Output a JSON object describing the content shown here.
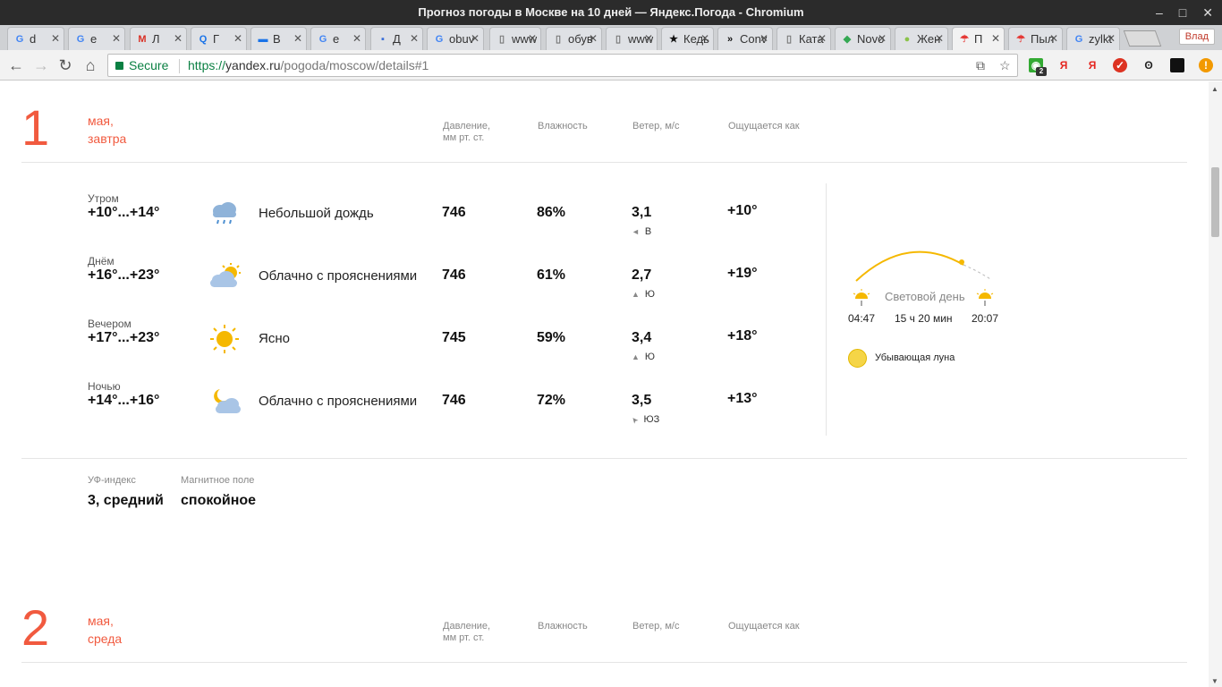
{
  "window": {
    "title": "Прогноз погоды в Москве на 10 дней — Яндекс.Погода - Chromium"
  },
  "tabs": [
    {
      "label": "d",
      "icon": "google-icon"
    },
    {
      "label": "e",
      "icon": "google-icon"
    },
    {
      "label": "Л",
      "icon": "gmail-icon"
    },
    {
      "label": "Г",
      "icon": "search-icon"
    },
    {
      "label": "B",
      "icon": "card-icon"
    },
    {
      "label": "e",
      "icon": "google-icon"
    },
    {
      "label": "Д",
      "icon": "chat-icon"
    },
    {
      "label": "obuv",
      "icon": "google-icon"
    },
    {
      "label": "www",
      "icon": "doc-icon"
    },
    {
      "label": "обув",
      "icon": "doc-icon"
    },
    {
      "label": "www",
      "icon": "doc-icon"
    },
    {
      "label": "Кедь",
      "icon": "star-icon"
    },
    {
      "label": "Conv",
      "icon": "converse-icon"
    },
    {
      "label": "Ката",
      "icon": "doc-icon"
    },
    {
      "label": "Novo",
      "icon": "maps-icon"
    },
    {
      "label": "Жен",
      "icon": "ball-icon"
    },
    {
      "label": "П",
      "icon": "umbrella-icon"
    },
    {
      "label": "Пыл",
      "icon": "umbrella-icon"
    },
    {
      "label": "zylkt",
      "icon": "google-icon"
    }
  ],
  "user_label": "Влад",
  "toolbar": {
    "secure": "Secure",
    "url_scheme": "https://",
    "url_host": "yandex.ru",
    "url_path": "/pogoda/moscow/details#1"
  },
  "extensions": {
    "badge": "2",
    "ya1": "Я",
    "ya2": "Я"
  },
  "day1": {
    "num": "1",
    "month": "мая,",
    "weekday": "завтра",
    "headers": {
      "pressure": "Давление,",
      "pressure_unit": "мм рт. ст.",
      "humidity": "Влажность",
      "wind": "Ветер, м/с",
      "feels": "Ощущается как"
    },
    "rows": [
      {
        "part": "Утром",
        "temp": "+10°...+14°",
        "icon": "rain-cloud-icon",
        "cond": "Небольшой дождь",
        "pressure": "746",
        "humidity": "86%",
        "wind": "3,1",
        "dir": "В",
        "dir_arrow": "◄",
        "feels": "+10°"
      },
      {
        "part": "Днём",
        "temp": "+16°...+23°",
        "icon": "partly-cloudy-icon",
        "cond": "Облачно с прояснениями",
        "pressure": "746",
        "humidity": "61%",
        "wind": "2,7",
        "dir": "Ю",
        "dir_arrow": "▲",
        "feels": "+19°"
      },
      {
        "part": "Вечером",
        "temp": "+17°...+23°",
        "icon": "sun-icon",
        "cond": "Ясно",
        "pressure": "745",
        "humidity": "59%",
        "wind": "3,4",
        "dir": "Ю",
        "dir_arrow": "▲",
        "feels": "+18°"
      },
      {
        "part": "Ночью",
        "temp": "+14°...+16°",
        "icon": "night-cloudy-icon",
        "cond": "Облачно с прояснениями",
        "pressure": "746",
        "humidity": "72%",
        "wind": "3,5",
        "dir": "ЮЗ",
        "dir_arrow": "➤",
        "feels": "+13°"
      }
    ],
    "sun": {
      "label": "Световой день",
      "rise": "04:47",
      "duration": "15 ч 20 мин",
      "set": "20:07"
    },
    "moon": "Убывающая луна",
    "uv_label": "УФ-индекс",
    "uv_value": "3, средний",
    "mag_label": "Магнитное поле",
    "mag_value": "спокойное"
  },
  "day2": {
    "num": "2",
    "month": "мая,",
    "weekday": "среда",
    "headers": {
      "pressure": "Давление,",
      "pressure_unit": "мм рт. ст.",
      "humidity": "Влажность",
      "wind": "Ветер, м/с",
      "feels": "Ощущается как"
    }
  },
  "colors": {
    "accent": "#f15a3f",
    "secure": "#0b8043",
    "sun": "#f5b800"
  }
}
